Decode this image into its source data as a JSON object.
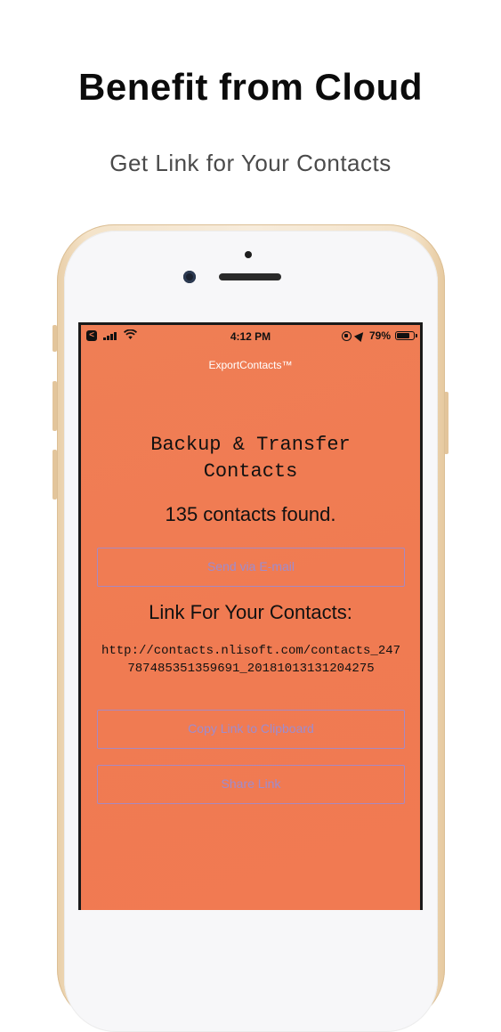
{
  "promo": {
    "title": "Benefit from Cloud",
    "subtitle": "Get Link for Your Contacts"
  },
  "status_bar": {
    "time": "4:12 PM",
    "battery_percent": "79%",
    "battery_level": 0.79,
    "back_app_glyph": "<"
  },
  "app": {
    "nav_title": "ExportContacts™",
    "headline": "Backup & Transfer Contacts",
    "count_text": "135 contacts found.",
    "send_email_label": "Send via E-mail",
    "link_heading": "Link For Your Contacts:",
    "link_url": "http://contacts.nlisoft.com/contacts_247787485351359691_20181013131204275",
    "copy_link_label": "Copy Link to Clipboard",
    "share_link_label": "Share Link"
  },
  "colors": {
    "screen_background": "#f07b52",
    "button_outline": "#a889c0",
    "button_text": "#9d8ccf"
  },
  "icons": [
    "back-app-icon",
    "signal-icon",
    "wifi-icon",
    "rotation-lock-icon",
    "location-icon",
    "battery-icon"
  ]
}
